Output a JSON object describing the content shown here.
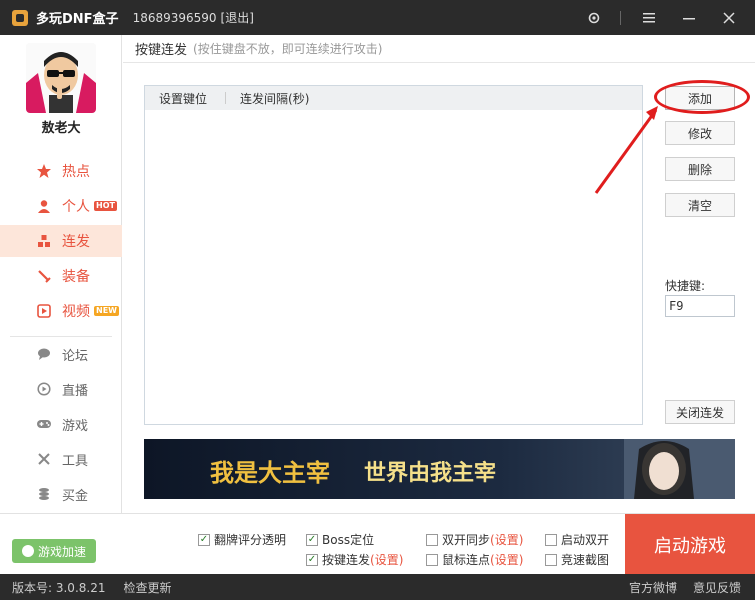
{
  "titlebar": {
    "app_title": "多玩DNF盒子",
    "phone": "18689396590",
    "logout": "[退出]",
    "icons": [
      "gear-icon",
      "menu-icon",
      "minimize-icon",
      "close-icon"
    ]
  },
  "sidebar": {
    "username": "敖老大",
    "primary_items": [
      {
        "label": "热点",
        "icon": "star-icon"
      },
      {
        "label": "个人",
        "icon": "user-icon",
        "badge": "HOT"
      },
      {
        "label": "连发",
        "icon": "blocks-icon",
        "active": true
      },
      {
        "label": "装备",
        "icon": "sword-icon"
      },
      {
        "label": "视频",
        "icon": "play-icon",
        "badge": "NEW"
      }
    ],
    "secondary_items": [
      {
        "label": "论坛",
        "icon": "chat-icon"
      },
      {
        "label": "直播",
        "icon": "live-icon"
      },
      {
        "label": "游戏",
        "icon": "gamepad-icon"
      },
      {
        "label": "工具",
        "icon": "tools-icon"
      },
      {
        "label": "买金",
        "icon": "coins-icon"
      }
    ]
  },
  "main": {
    "header_title": "按键连发",
    "header_hint": "(按住键盘不放，即可连续进行攻击)",
    "table_headers": [
      "设置键位",
      "连发间隔(秒)"
    ],
    "buttons": {
      "add": "添加",
      "edit": "修改",
      "delete": "删除",
      "clear": "清空",
      "close_burst": "关闭连发"
    },
    "hotkey_label": "快捷键:",
    "hotkey_value": "F9",
    "banner": {
      "left_text": "我是大主宰",
      "center_text": "世界由我主宰"
    }
  },
  "bottom": {
    "boost_label": "游戏加速",
    "options": [
      {
        "label": "翻牌评分透明",
        "checked": true
      },
      {
        "label": "Boss定位",
        "checked": true
      },
      {
        "label": "双开同步",
        "link": "(设置)",
        "checked": false
      },
      {
        "label": "启动双开",
        "checked": false
      },
      {
        "label": "按键连发",
        "link": "(设置)",
        "checked": true
      },
      {
        "label": "鼠标连点",
        "link": "(设置)",
        "checked": false
      },
      {
        "label": "竞速截图",
        "checked": false
      }
    ],
    "start_label": "启动游戏"
  },
  "status": {
    "version": "版本号: 3.0.8.21",
    "check_update": "检查更新",
    "weibo": "官方微博",
    "feedback": "意见反馈"
  },
  "colors": {
    "accent": "#e8543f",
    "titlebar_bg": "#2b2b2b",
    "active_bg": "#fde6da",
    "boost_green": "#7cc36a",
    "annotation_red": "#e01d1d"
  }
}
